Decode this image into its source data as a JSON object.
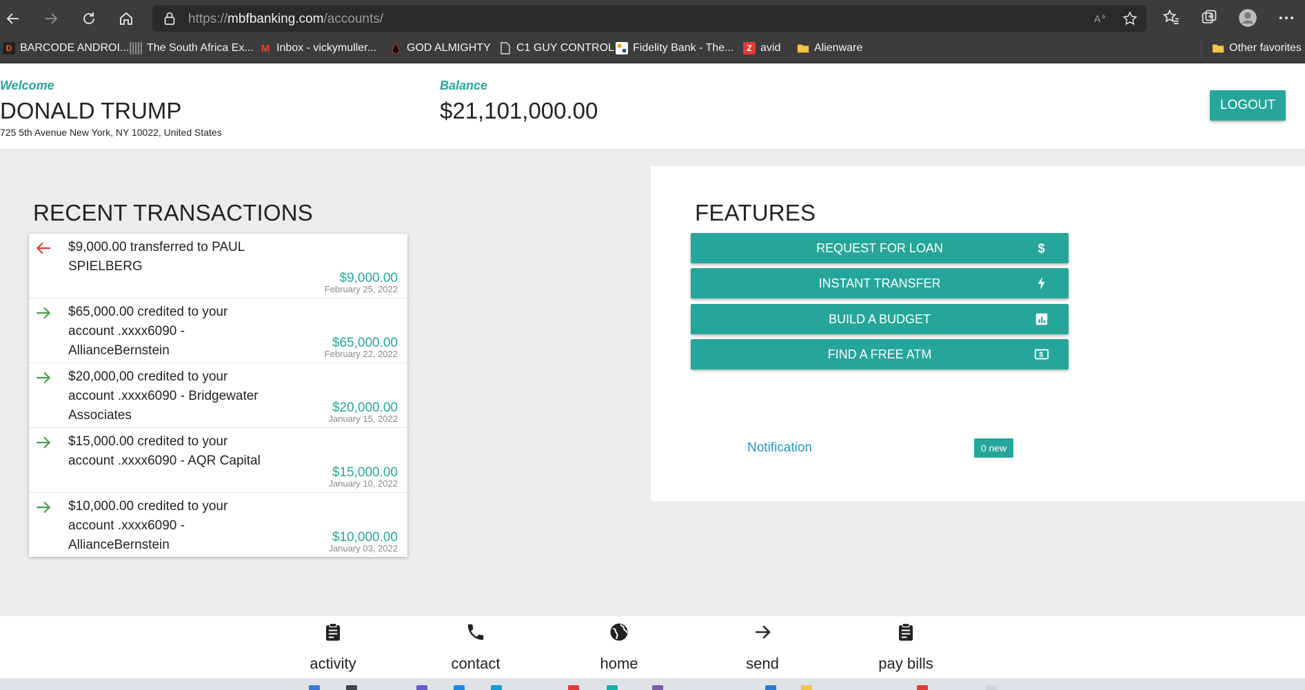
{
  "browser": {
    "url_scheme": "https://",
    "url_host": "mbfbanking.com",
    "url_path": "/accounts/",
    "bookmarks": [
      {
        "label": "BARCODE ANDROI...",
        "icon": "D"
      },
      {
        "label": "The South Africa Ex...",
        "icon": "bars"
      },
      {
        "label": "Inbox - vickymuller...",
        "icon": "M"
      },
      {
        "label": "GOD ALMIGHTY",
        "icon": "drop"
      },
      {
        "label": "C1 GUY CONTROL",
        "icon": "page"
      },
      {
        "label": "Fidelity Bank - The...",
        "icon": "fb"
      },
      {
        "label": "avid",
        "icon": "Z"
      },
      {
        "label": "Alienware",
        "icon": "folder"
      }
    ],
    "other_favorites": "Other favorites"
  },
  "header": {
    "welcome_label": "Welcome",
    "user_name": "DONALD TRUMP",
    "address": "725 5th Avenue New York, NY 10022, United States",
    "balance_label": "Balance",
    "balance": "$21,101,000.00",
    "logout": "LOGOUT"
  },
  "transactions": {
    "title": "RECENT TRANSACTIONS",
    "items": [
      {
        "direction": "out",
        "description": "$9,000.00 transferred to PAUL SPIELBERG",
        "amount": "$9,000.00",
        "date": "February 25, 2022"
      },
      {
        "direction": "in",
        "description": "$65,000.00 credited to your account .xxxx6090 - AllianceBernstein",
        "amount": "$65,000.00",
        "date": "February 22, 2022"
      },
      {
        "direction": "in",
        "description": "$20,000,00 credited to your account .xxxx6090 - Bridgewater Associates",
        "amount": "$20,000.00",
        "date": "January 15, 2022"
      },
      {
        "direction": "in",
        "description": "$15,000.00 credited to your account .xxxx6090 - AQR Capital",
        "amount": "$15,000.00",
        "date": "January 10, 2022"
      },
      {
        "direction": "in",
        "description": "$10,000.00 credited to your account .xxxx6090 - AllianceBernstein",
        "amount": "$10,000.00",
        "date": "January 03, 2022"
      }
    ]
  },
  "features": {
    "title": "FEATURES",
    "buttons": [
      {
        "label": "REQUEST FOR LOAN",
        "icon": "dollar-icon"
      },
      {
        "label": "INSTANT TRANSFER",
        "icon": "bolt-icon"
      },
      {
        "label": "BUILD A BUDGET",
        "icon": "chart-icon"
      },
      {
        "label": "FIND A FREE ATM",
        "icon": "cash-icon"
      }
    ],
    "notification_label": "Notification",
    "notification_badge": "0 new"
  },
  "bottom_nav": [
    {
      "label": "activity",
      "icon": "clipboard-icon"
    },
    {
      "label": "contact",
      "icon": "phone-icon"
    },
    {
      "label": "home",
      "icon": "globe-icon"
    },
    {
      "label": "send",
      "icon": "arrow-right-icon"
    },
    {
      "label": "pay bills",
      "icon": "clipboard-icon"
    }
  ],
  "colors": {
    "accent": "#26a69a",
    "incoming": "#43a047",
    "outgoing": "#e53935",
    "link": "#2196c8"
  }
}
